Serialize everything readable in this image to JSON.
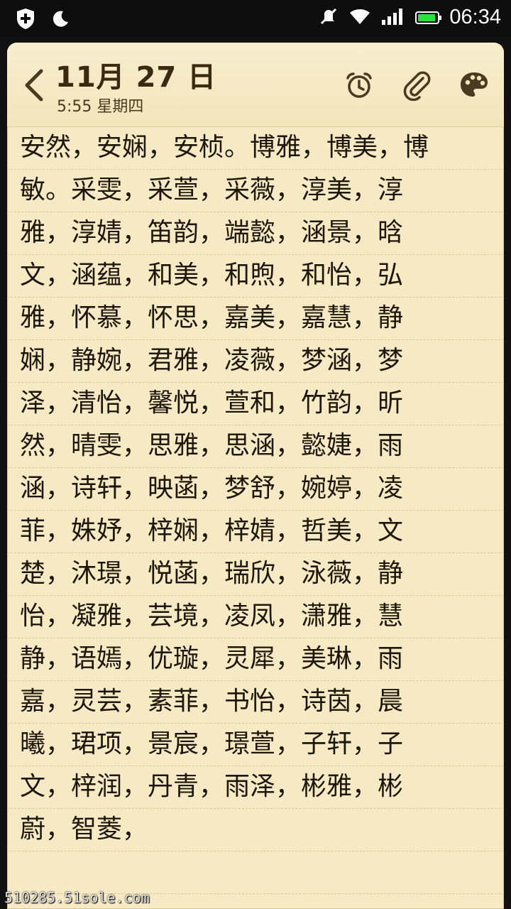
{
  "status_bar": {
    "time": "06:34",
    "battery_level": 0.9,
    "battery_color": "#29e33a",
    "icons": [
      "shield-plus-icon",
      "moon-icon",
      "mute-icon",
      "wifi-icon",
      "signal-icon",
      "battery-icon"
    ]
  },
  "header": {
    "date": "11月 27 日",
    "subtitle": "5:55 星期四",
    "icons": [
      "back-chevron-icon",
      "alarm-clock-icon",
      "paperclip-icon",
      "palette-icon"
    ]
  },
  "note": {
    "lines": [
      "安然，安娴，安桢。博雅，博美，博",
      "敏。采雯，采萱，采薇，淳美，淳",
      "雅，淳婧，笛韵，端懿，涵景，晗",
      "文，涵蕴，和美，和煦，和怡，弘",
      "雅，怀慕，怀思，嘉美，嘉慧，静",
      "娴，静婉，君雅，凌薇，梦涵，梦",
      "泽，清怡，馨悦，萱和，竹韵，昕",
      "然，晴雯，思雅，思涵，懿婕，雨",
      "涵，诗轩，映菡，梦舒，婉婷，凌",
      "菲，姝妤，梓娴，梓婧，哲美，文",
      "楚，沐璟，悦菡，瑞欣，泳薇，静",
      "怡，凝雅，芸境，凌凤，潇雅，慧",
      "静，语嫣，优璇，灵犀，美琳，雨",
      "嘉，灵芸，素菲，书怡，诗茵，晨",
      "曦，珺项，景宸，璟萱，子轩，子",
      "文，梓润，丹青，雨泽，彬雅，彬",
      "蔚，智菱，",
      ""
    ]
  },
  "watermark": "510285.51sole.com",
  "colors": {
    "paper": "#f6eac4",
    "ink": "#1e1608",
    "accent": "#3a2a12"
  }
}
